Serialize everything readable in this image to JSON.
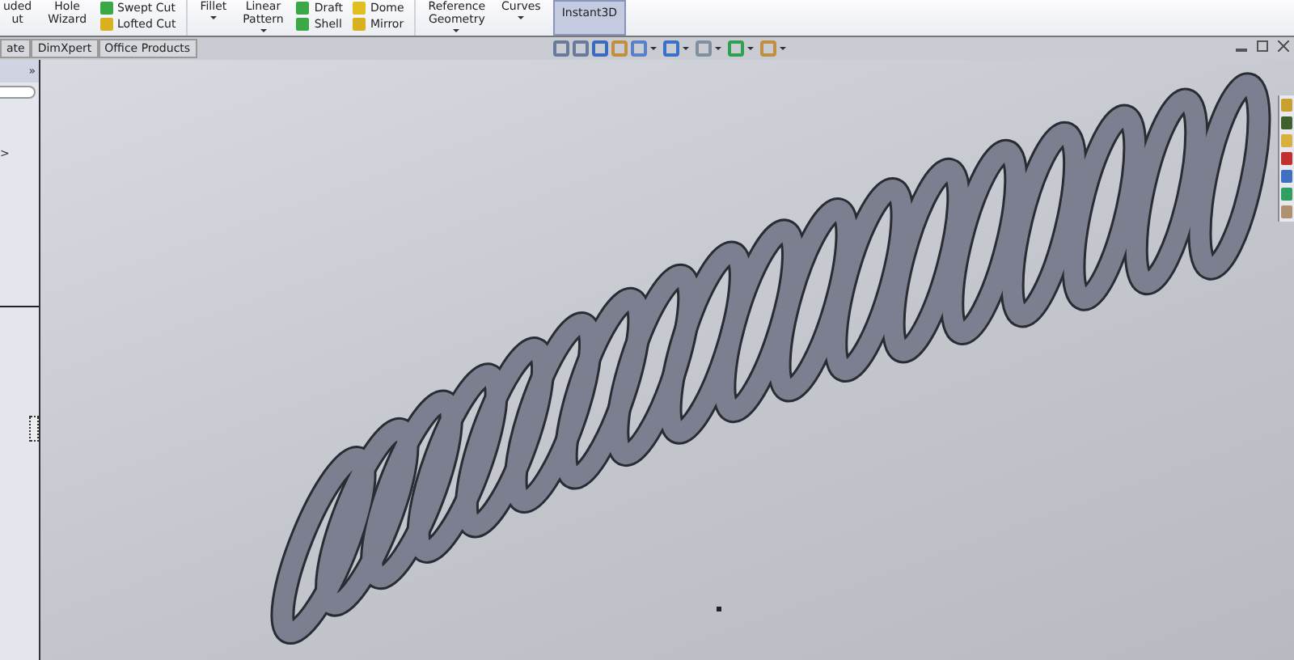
{
  "ribbon": [
    {
      "kind": "large",
      "lines": [
        "uded",
        "ut"
      ],
      "on": false,
      "dropdown": false
    },
    {
      "kind": "large",
      "lines": [
        "Hole",
        "Wizard"
      ],
      "on": false,
      "dropdown": false
    },
    {
      "kind": "stack",
      "items": [
        {
          "label": "Swept Cut",
          "color": "#3aa845"
        },
        {
          "label": "Lofted Cut",
          "color": "#d8b020"
        }
      ]
    },
    {
      "kind": "large",
      "lines": [
        "Fillet"
      ],
      "on": false,
      "dropdown": true
    },
    {
      "kind": "large",
      "lines": [
        "Linear",
        "Pattern"
      ],
      "on": false,
      "dropdown": true
    },
    {
      "kind": "stack",
      "items": [
        {
          "label": "Draft",
          "color": "#3aa845"
        },
        {
          "label": "Shell",
          "color": "#3aa845"
        }
      ]
    },
    {
      "kind": "stack",
      "items": [
        {
          "label": "Dome",
          "color": "#e0c020"
        },
        {
          "label": "Mirror",
          "color": "#d8b020"
        }
      ]
    },
    {
      "kind": "large",
      "lines": [
        "Reference",
        "Geometry"
      ],
      "on": false,
      "dropdown": true
    },
    {
      "kind": "large",
      "lines": [
        "Curves"
      ],
      "on": false,
      "dropdown": true
    },
    {
      "kind": "large",
      "lines": [
        "Instant3D"
      ],
      "on": true,
      "dropdown": false
    }
  ],
  "tabs": [
    {
      "label": "ate"
    },
    {
      "label": "DimXpert"
    },
    {
      "label": "Office Products"
    }
  ],
  "left_panel": {
    "expand": "»",
    "arrow": ">"
  }
}
